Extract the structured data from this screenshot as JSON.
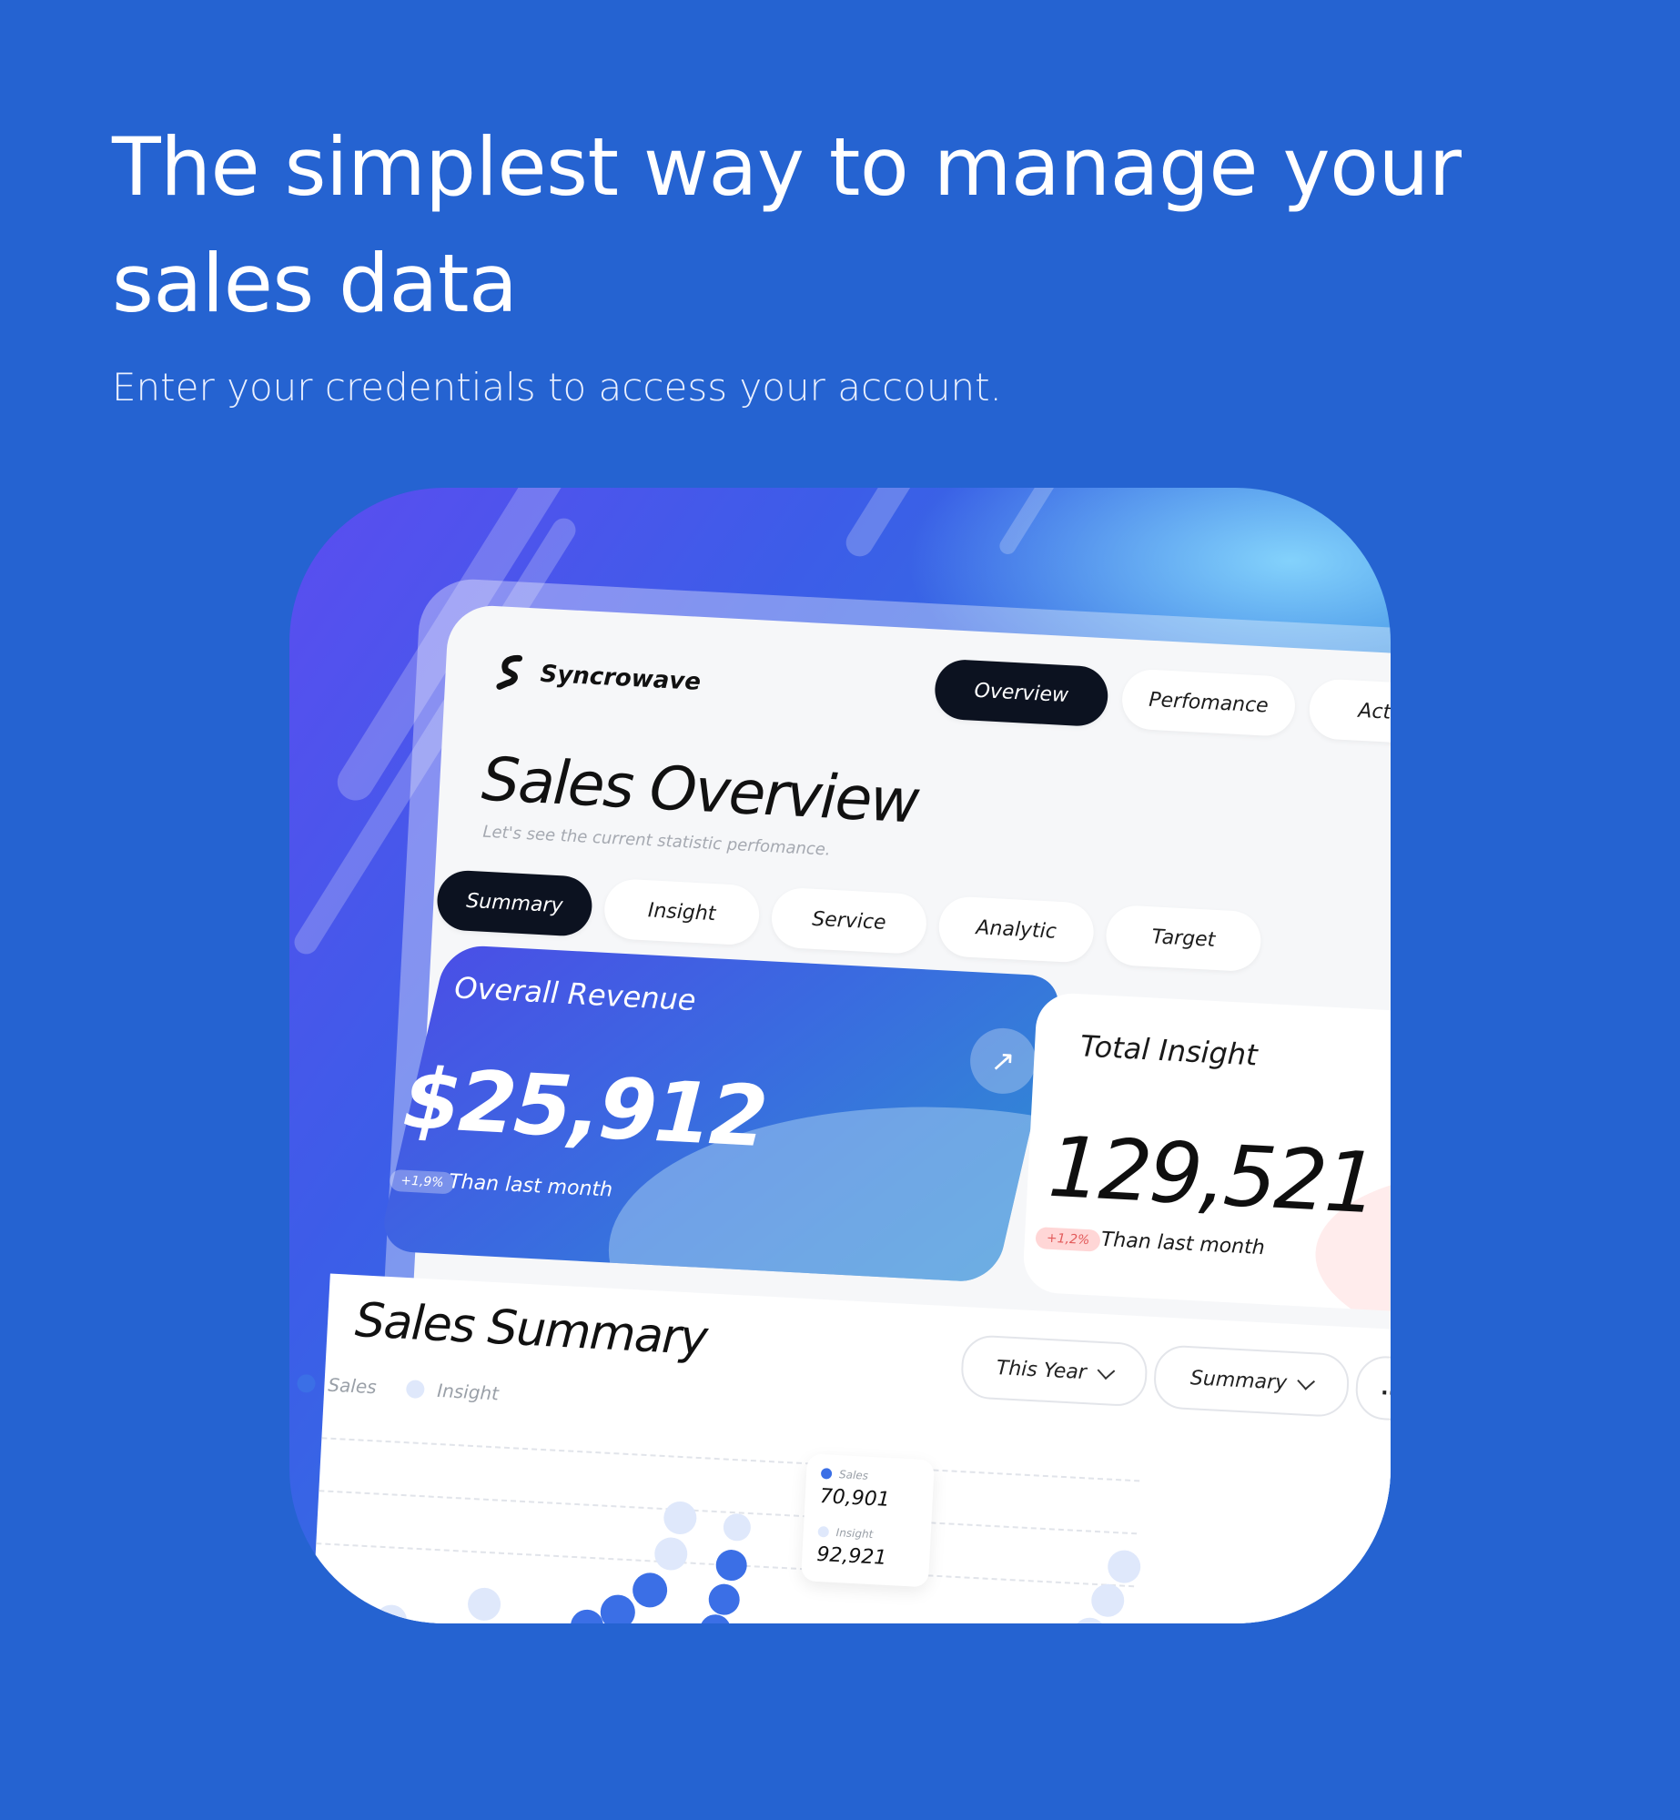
{
  "hero": {
    "title": "The simplest way to manage your sales data",
    "subtitle": "Enter your credentials to access your account."
  },
  "dashboard": {
    "brand": "Syncrowave",
    "top_tabs": [
      "Overview",
      "Perfomance",
      "Activity"
    ],
    "active_top_tab": "Overview",
    "page_title": "Sales Overview",
    "page_subtitle": "Let's see the current statistic perfomance.",
    "filter_tabs": [
      "Summary",
      "Insight",
      "Service",
      "Analytic",
      "Target"
    ],
    "active_filter_tab": "Summary",
    "revenue_card": {
      "label": "Overall Revenue",
      "value": "$25,912",
      "badge": "+1,9%",
      "delta_text": "Than last month"
    },
    "insight_card": {
      "label": "Total Insight",
      "value": "129,521",
      "badge": "+1,2%",
      "delta_text": "Than last month"
    },
    "sales_summary": {
      "title": "Sales Summary",
      "legend": [
        "Sales",
        "Insight"
      ],
      "period_select": "This Year",
      "view_select": "Summary",
      "more_label": "...",
      "tooltip": {
        "sales_label": "Sales",
        "sales_value": "70,901",
        "insight_label": "Insight",
        "insight_value": "92,921"
      }
    }
  },
  "colors": {
    "page_bg": "#2563d1",
    "accent_blue": "#3b6fe6",
    "light_blue": "#dfe8fb",
    "dark_pill": "#0c1220",
    "negative_badge": "#ffd6d6"
  }
}
